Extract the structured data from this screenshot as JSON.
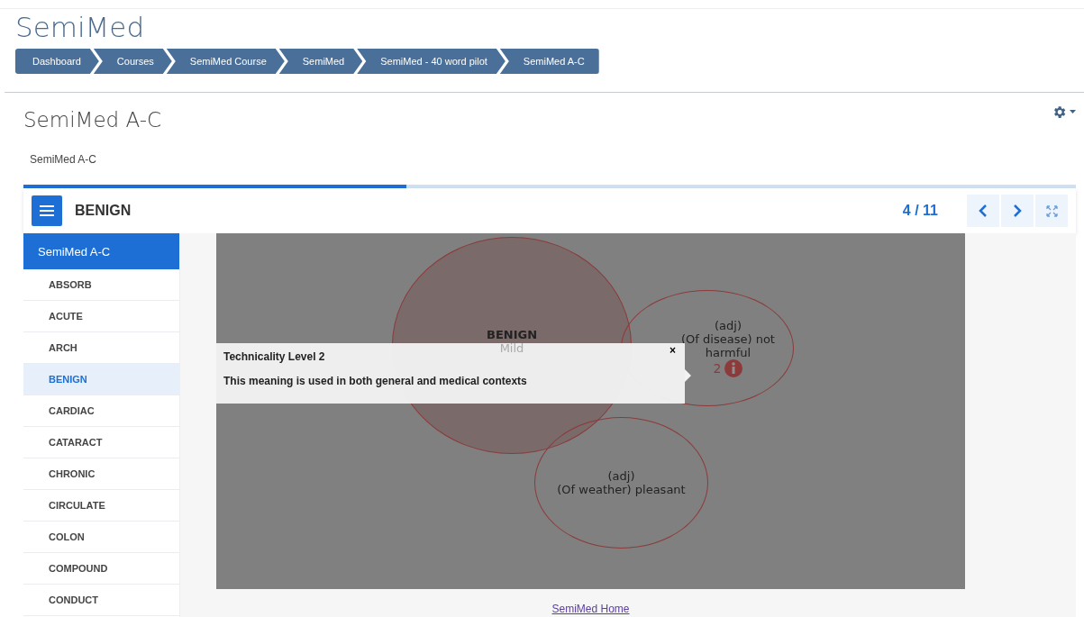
{
  "site_title": "SemiMed",
  "breadcrumbs": [
    "Dashboard",
    "Courses",
    "SemiMed Course",
    "SemiMed",
    "SemiMed - 40 word pilot",
    "SemiMed A-C"
  ],
  "page_title": "SemiMed A-C",
  "intro": "SemiMed A-C",
  "book": {
    "progress": {
      "level": 0.364
    },
    "title": "BENIGN",
    "counter": "4 / 11",
    "sidebar": {
      "heading": "SemiMed A-C",
      "items": [
        {
          "label": "ABSORB",
          "selected": false
        },
        {
          "label": "ACUTE",
          "selected": false
        },
        {
          "label": "ARCH",
          "selected": false
        },
        {
          "label": "BENIGN",
          "selected": true
        },
        {
          "label": "CARDIAC",
          "selected": false
        },
        {
          "label": "CATARACT",
          "selected": false
        },
        {
          "label": "CHRONIC",
          "selected": false
        },
        {
          "label": "CIRCULATE",
          "selected": false
        },
        {
          "label": "COLON",
          "selected": false
        },
        {
          "label": "COMPOUND",
          "selected": false
        },
        {
          "label": "CONDUCT",
          "selected": false
        }
      ]
    },
    "diagram": {
      "word": "BENIGN",
      "gloss": "Mild",
      "senses": [
        {
          "pos": "(adj)",
          "meaning": "(Of disease) not harmful",
          "level": "2"
        },
        {
          "pos": "(adj)",
          "meaning": "(Of weather) pleasant"
        }
      ],
      "popup": {
        "title": "Technicality Level 2",
        "text": "This meaning is used in both general and medical contexts",
        "close": "×"
      }
    },
    "footer_link": "SemiMed Home"
  }
}
